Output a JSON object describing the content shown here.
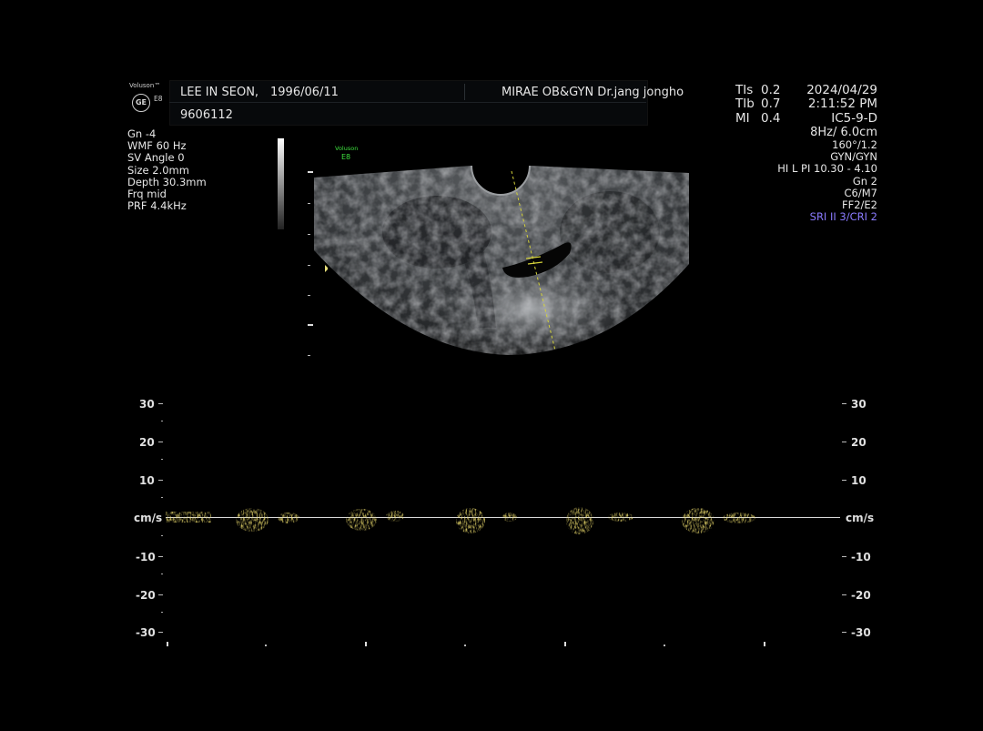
{
  "header": {
    "brand": "Voluson™",
    "model": "E8",
    "ge": "GE",
    "patient_name": "LEE IN SEON,",
    "dob": "1996/06/11",
    "patient_id": "9606112",
    "clinic": "MIRAE OB&GYN Dr.jang jongho",
    "tis_label": "TIs",
    "tis_val": "0.2",
    "tib_label": "TIb",
    "tib_val": "0.7",
    "mi_label": "MI",
    "mi_val": "0.4",
    "date": "2024/04/29",
    "time": "2:11:52 PM",
    "probe": "IC5-9-D"
  },
  "left_params": [
    "Gn  -4",
    "WMF 60 Hz",
    "SV Angle  0",
    "Size  2.0mm",
    "Depth 30.3mm",
    "Frq mid",
    "PRF  4.4kHz"
  ],
  "right_params": {
    "freq": "8Hz/ 6.0cm",
    "lines": [
      "160°/1.2",
      "GYN/GYN",
      "HI L PI 10.30 - 4.10",
      "Gn  2",
      "C6/M7",
      "FF2/E2"
    ],
    "sri": "SRI II 3/CRI 2"
  },
  "image_label": {
    "brand": "Voluson",
    "model": "E8"
  },
  "doppler": {
    "unit": "cm/s",
    "left_ticks": [
      "30",
      "20",
      "10",
      "-10",
      "-20",
      "-30"
    ],
    "right_ticks": [
      "30",
      "20",
      "10",
      "-10",
      "-20",
      "-30"
    ]
  },
  "colors": {
    "accent_green": "#3de03d",
    "sri_blue": "#8a7bff",
    "doppler_yellow": "#c9b52a"
  }
}
